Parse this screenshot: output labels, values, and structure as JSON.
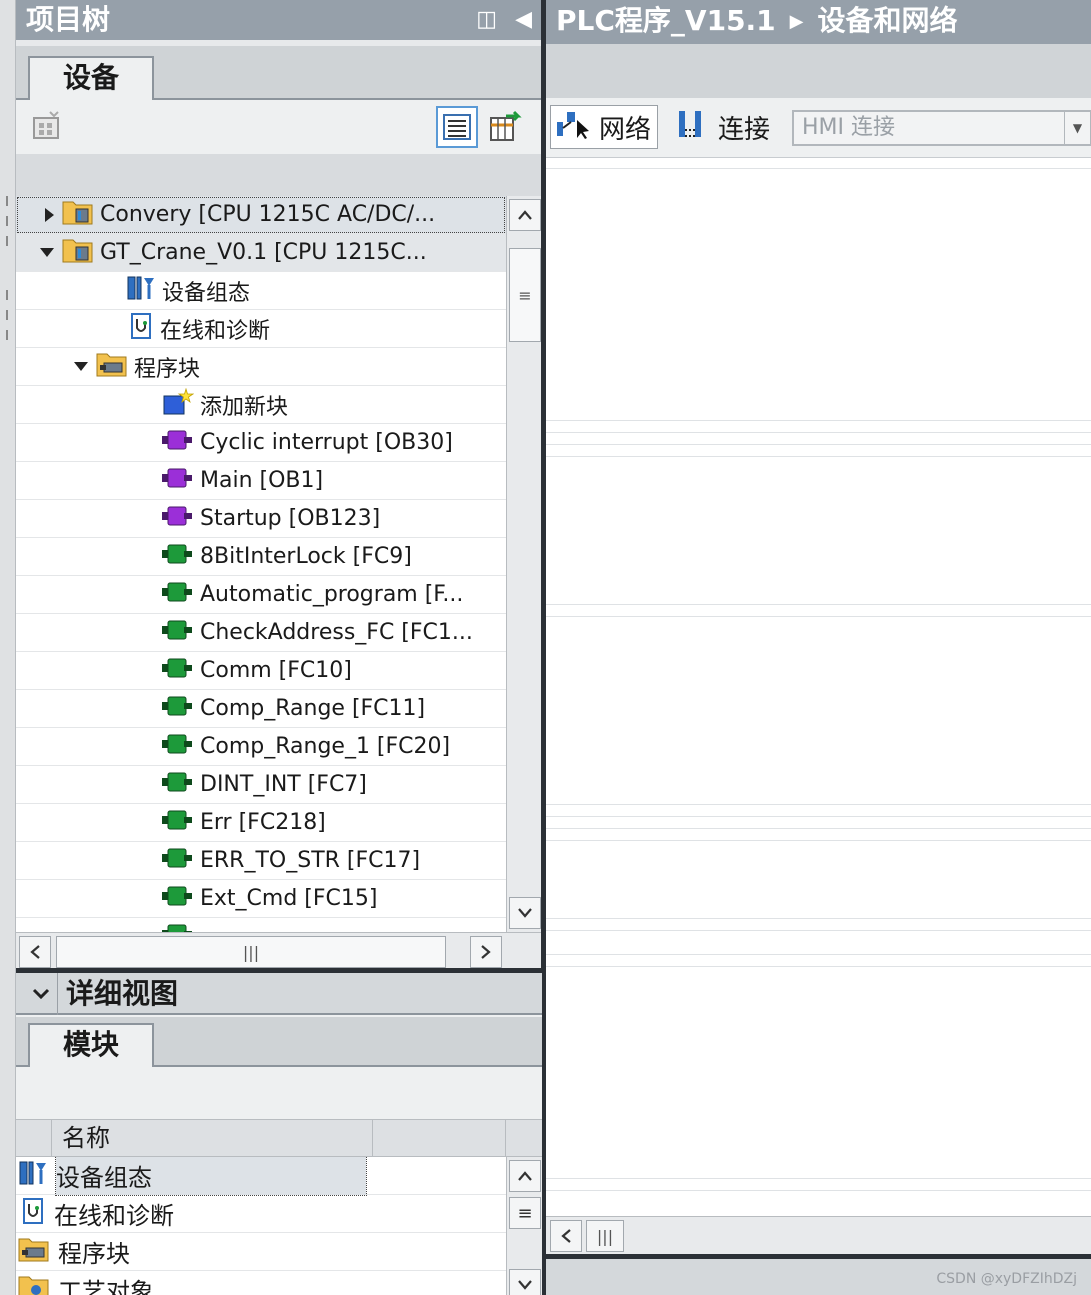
{
  "project_tree": {
    "title": "项目树",
    "tab_label": "设备",
    "items": [
      {
        "label": "Convery [CPU 1215C AC/DC/...",
        "icon": "plc-folder-icon",
        "expander": "collapsed"
      },
      {
        "label": "GT_Crane_V0.1 [CPU 1215C...",
        "icon": "plc-folder-icon",
        "expander": "expanded"
      },
      {
        "label": "设备组态",
        "icon": "device-config-icon",
        "expander": "none"
      },
      {
        "label": "在线和诊断",
        "icon": "online-diagnostics-icon",
        "expander": "none"
      },
      {
        "label": "程序块",
        "icon": "program-blocks-folder-icon",
        "expander": "expanded"
      },
      {
        "label": "添加新块",
        "icon": "add-new-block-icon",
        "expander": "none"
      },
      {
        "label": "Cyclic interrupt [OB30]",
        "icon": "ob-block-icon",
        "expander": "none"
      },
      {
        "label": "Main [OB1]",
        "icon": "ob-block-icon",
        "expander": "none"
      },
      {
        "label": "Startup [OB123]",
        "icon": "ob-block-icon",
        "expander": "none"
      },
      {
        "label": "8BitInterLock [FC9]",
        "icon": "fc-block-icon",
        "expander": "none"
      },
      {
        "label": "Automatic_program [F...",
        "icon": "fc-block-icon",
        "expander": "none"
      },
      {
        "label": "CheckAddress_FC [FC1...",
        "icon": "fc-block-icon",
        "expander": "none"
      },
      {
        "label": "Comm [FC10]",
        "icon": "fc-block-icon",
        "expander": "none"
      },
      {
        "label": "Comp_Range [FC11]",
        "icon": "fc-block-icon",
        "expander": "none"
      },
      {
        "label": "Comp_Range_1 [FC20]",
        "icon": "fc-block-icon",
        "expander": "none"
      },
      {
        "label": "DINT_INT [FC7]",
        "icon": "fc-block-icon",
        "expander": "none"
      },
      {
        "label": "Err [FC218]",
        "icon": "fc-block-icon",
        "expander": "none"
      },
      {
        "label": "ERR_TO_STR [FC17]",
        "icon": "fc-block-icon",
        "expander": "none"
      },
      {
        "label": "Ext_Cmd [FC15]",
        "icon": "fc-block-icon",
        "expander": "none"
      }
    ]
  },
  "details_view": {
    "title": "详细视图",
    "tab_label": "模块",
    "column_name": "名称",
    "items": [
      {
        "label": "设备组态",
        "icon": "device-config-icon"
      },
      {
        "label": "在线和诊断",
        "icon": "online-diagnostics-icon"
      },
      {
        "label": "程序块",
        "icon": "program-blocks-folder-icon"
      },
      {
        "label": "工艺对象",
        "icon": "technology-objects-icon"
      }
    ]
  },
  "editor": {
    "breadcrumb": [
      "PLC程序_V15.1",
      "设备和网络"
    ],
    "network_button": "网络",
    "connections_button": "连接",
    "hmi_connection_value": "HMI 连接"
  },
  "watermark": "CSDN @xyDFZIhDZj",
  "colors": {
    "title_bar": "#96a0aa",
    "ob_block": "#9b2fd8",
    "fc_block": "#1d9a3a",
    "divider": "#2b3036"
  }
}
